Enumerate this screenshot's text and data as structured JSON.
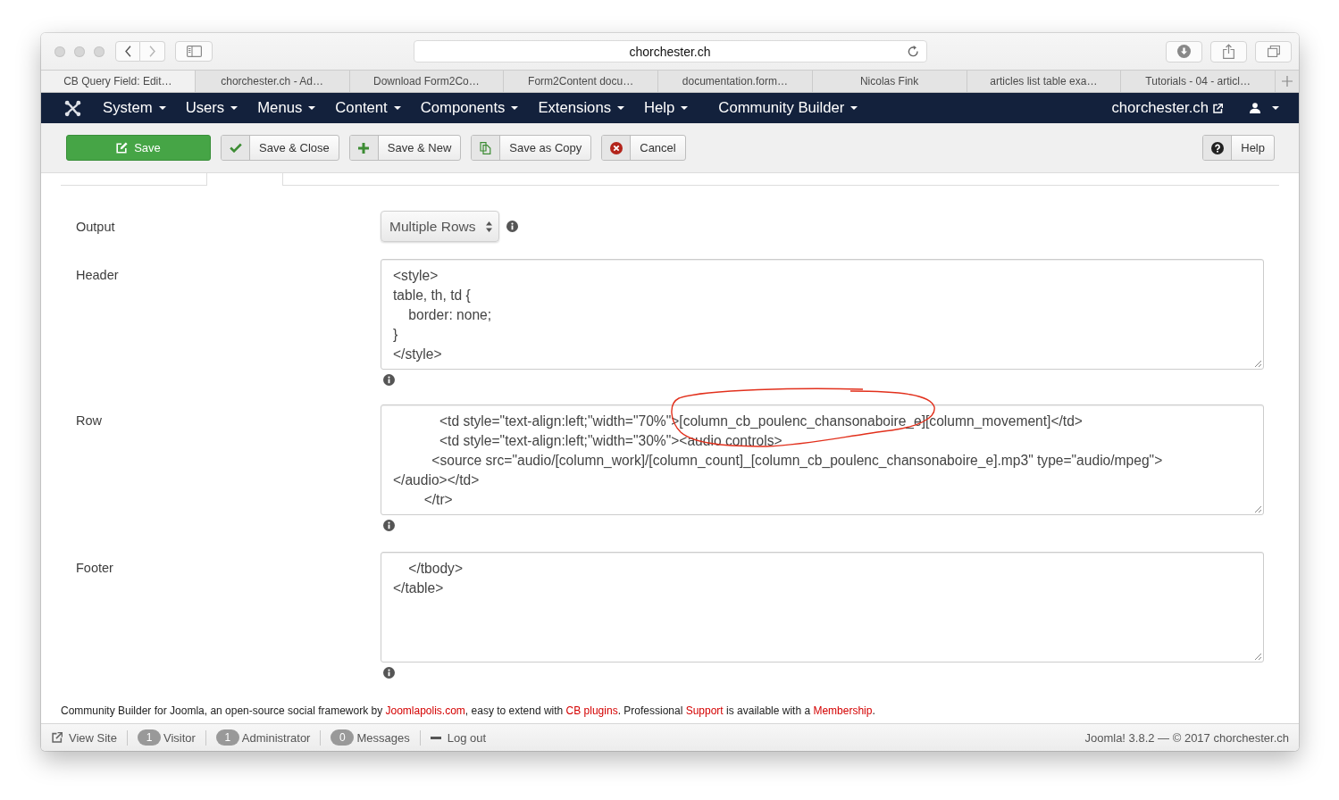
{
  "browser": {
    "url": "chorchester.ch",
    "back": {
      "disabled": false
    },
    "forward": {
      "disabled": true
    },
    "tabs": [
      {
        "label": "CB Query Field: Edit…",
        "selected": true
      },
      {
        "label": "chorchester.ch - Ad…",
        "selected": false
      },
      {
        "label": "Download Form2Co…",
        "selected": false
      },
      {
        "label": "Form2Content docu…",
        "selected": false
      },
      {
        "label": "documentation.form…",
        "selected": false
      },
      {
        "label": "Nicolas Fink",
        "selected": false
      },
      {
        "label": "articles list table exa…",
        "selected": false
      },
      {
        "label": "Tutorials - 04 - articl…",
        "selected": false
      }
    ]
  },
  "navbar": {
    "menus": [
      "System",
      "Users",
      "Menus",
      "Content",
      "Components",
      "Extensions",
      "Help",
      "Community Builder"
    ],
    "site_link": "chorchester.ch"
  },
  "toolbar": {
    "buttons": [
      {
        "kind": "save",
        "label": "Save"
      },
      {
        "kind": "check",
        "label": "Save & Close"
      },
      {
        "kind": "plus",
        "label": "Save & New"
      },
      {
        "kind": "copy",
        "label": "Save as Copy"
      },
      {
        "kind": "cancel",
        "label": "Cancel"
      }
    ],
    "help": {
      "kind": "help",
      "label": "Help"
    }
  },
  "form": {
    "fields": [
      {
        "label": "Output",
        "kind": "select",
        "value": "Multiple Rows",
        "annotated": false
      },
      {
        "label": "Header",
        "kind": "textarea",
        "value": "<style>\ntable, th, td {\n    border: none;\n}\n</style>",
        "annotated": false
      },
      {
        "label": "Row",
        "kind": "textarea",
        "value": "            <td style=\"text-align:left;\"width=\"70%\">[column_cb_poulenc_chansonaboire_e][column_movement]</td>\n            <td style=\"text-align:left;\"width=\"30%\"><audio controls>\n          <source src=\"audio/[column_work]/[column_count]_[column_cb_poulenc_chansonaboire_e].mp3\" type=\"audio/mpeg\">\n</audio></td>\n        </tr>",
        "annotated": true
      },
      {
        "label": "Footer",
        "kind": "textarea",
        "value": "    </tbody>\n</table>",
        "annotated": false
      }
    ]
  },
  "credits": [
    {
      "kind": "text",
      "text": "Community Builder for Joomla, an open-source social framework by "
    },
    {
      "kind": "link",
      "text": "Joomlapolis.com"
    },
    {
      "kind": "text",
      "text": ", easy to extend with "
    },
    {
      "kind": "link",
      "text": "CB plugins"
    },
    {
      "kind": "text",
      "text": ". Professional "
    },
    {
      "kind": "link",
      "text": "Support"
    },
    {
      "kind": "text",
      "text": " is available with a "
    },
    {
      "kind": "link",
      "text": "Membership"
    },
    {
      "kind": "text",
      "text": "."
    }
  ],
  "status_bar": {
    "items": [
      {
        "kind": "external",
        "label": "View Site"
      },
      {
        "kind": "count",
        "count": "1",
        "label": "Visitor"
      },
      {
        "kind": "count",
        "count": "1",
        "label": "Administrator"
      },
      {
        "kind": "count",
        "count": "0",
        "label": "Messages"
      },
      {
        "kind": "minus",
        "label": "Log out"
      }
    ],
    "version": "Joomla! 3.8.2 — © 2017 chorchester.ch"
  }
}
